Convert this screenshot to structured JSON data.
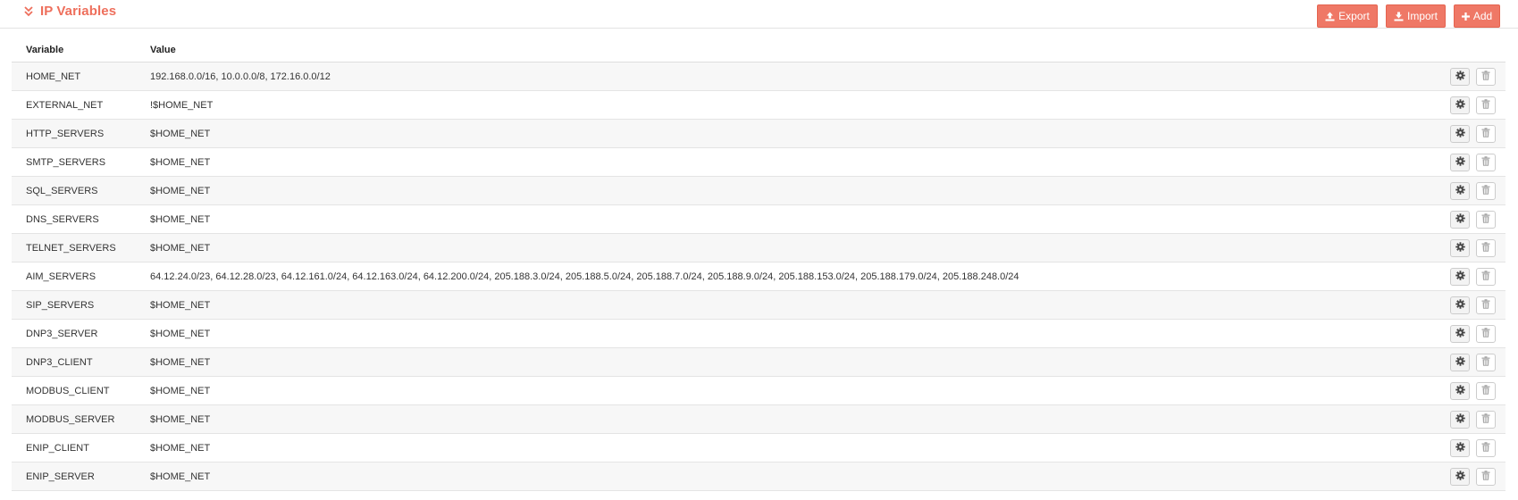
{
  "panel": {
    "title": "IP Variables",
    "collapse_icon": "double-chevron-down-icon",
    "accent_color": "#ee6f5c",
    "buttons": {
      "export_label": "Export",
      "import_label": "Import",
      "add_label": "Add",
      "export_icon": "upload-icon",
      "import_icon": "download-icon",
      "add_icon": "plus-icon"
    }
  },
  "table": {
    "headers": {
      "variable": "Variable",
      "value": "Value"
    },
    "row_actions": {
      "edit_icon": "gear-icon",
      "delete_icon": "trash-icon"
    },
    "rows": [
      {
        "variable": "HOME_NET",
        "value": "192.168.0.0/16, 10.0.0.0/8, 172.16.0.0/12"
      },
      {
        "variable": "EXTERNAL_NET",
        "value": "!$HOME_NET"
      },
      {
        "variable": "HTTP_SERVERS",
        "value": "$HOME_NET"
      },
      {
        "variable": "SMTP_SERVERS",
        "value": "$HOME_NET"
      },
      {
        "variable": "SQL_SERVERS",
        "value": "$HOME_NET"
      },
      {
        "variable": "DNS_SERVERS",
        "value": "$HOME_NET"
      },
      {
        "variable": "TELNET_SERVERS",
        "value": "$HOME_NET"
      },
      {
        "variable": "AIM_SERVERS",
        "value": "64.12.24.0/23, 64.12.28.0/23, 64.12.161.0/24, 64.12.163.0/24, 64.12.200.0/24, 205.188.3.0/24, 205.188.5.0/24, 205.188.7.0/24, 205.188.9.0/24, 205.188.153.0/24, 205.188.179.0/24, 205.188.248.0/24"
      },
      {
        "variable": "SIP_SERVERS",
        "value": "$HOME_NET"
      },
      {
        "variable": "DNP3_SERVER",
        "value": "$HOME_NET"
      },
      {
        "variable": "DNP3_CLIENT",
        "value": "$HOME_NET"
      },
      {
        "variable": "MODBUS_CLIENT",
        "value": "$HOME_NET"
      },
      {
        "variable": "MODBUS_SERVER",
        "value": "$HOME_NET"
      },
      {
        "variable": "ENIP_CLIENT",
        "value": "$HOME_NET"
      },
      {
        "variable": "ENIP_SERVER",
        "value": "$HOME_NET"
      }
    ]
  }
}
